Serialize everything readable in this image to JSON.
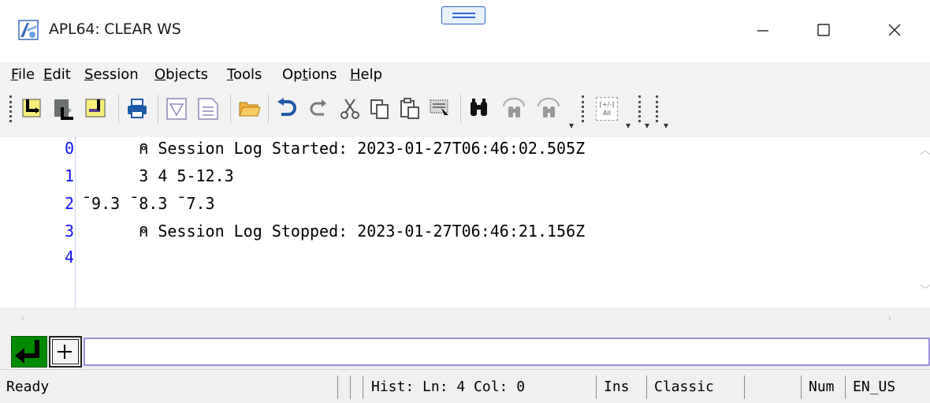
{
  "window": {
    "title": "APL64: CLEAR WS",
    "minimize_icon": "minimize-icon",
    "maximize_icon": "maximize-icon",
    "close_icon": "close-icon"
  },
  "menu": {
    "items": [
      {
        "hot": "F",
        "rest": "ile"
      },
      {
        "hot": "E",
        "rest": "dit"
      },
      {
        "hot": "S",
        "rest": "ession"
      },
      {
        "hot": "O",
        "rest": "bjects"
      },
      {
        "hot": "T",
        "rest": "ools"
      },
      {
        "pre": "Op",
        "hot": "t",
        "rest": "ions"
      },
      {
        "hot": "H",
        "rest": "elp"
      }
    ]
  },
  "toolbar": {
    "icons": [
      "step-into-icon",
      "step-over-icon",
      "step-out-icon",
      "print-icon",
      "filter-icon",
      "document-icon",
      "open-folder-icon",
      "undo-icon",
      "redo-icon",
      "cut-icon",
      "copy-icon",
      "paste-icon",
      "select-block-icon",
      "find-icon",
      "find-previous-icon",
      "find-next-icon",
      "toggle-all-icon"
    ],
    "toggle_all_label_top": "[+/-]",
    "toggle_all_label_bottom": "All"
  },
  "session": {
    "lines": [
      {
        "num": "0",
        "text": "      ⍝ Session Log Started: 2023-01-27T06:46:02.505Z"
      },
      {
        "num": "1",
        "text": "      3 4 5-12.3"
      },
      {
        "num": "2",
        "text": "¯9.3 ¯8.3 ¯7.3"
      },
      {
        "num": "3",
        "text": "      ⍝ Session Log Stopped: 2023-01-27T06:46:21.156Z"
      },
      {
        "num": "4",
        "text": ""
      }
    ]
  },
  "input": {
    "value": "",
    "enter_icon": "enter-icon",
    "expand_icon": "expand-plus-icon"
  },
  "status": {
    "state": "Ready",
    "history": "Hist: Ln: 4 Col: 0",
    "insert_mode": "Ins",
    "keyboard_mode": "Classic",
    "num_lock": "Num",
    "locale": "EN_US"
  },
  "colors": {
    "line_numbers": "#1010ff",
    "enter_button": "#008a00",
    "input_border": "#9a8fd9",
    "chrome": "#f2f2f2"
  }
}
